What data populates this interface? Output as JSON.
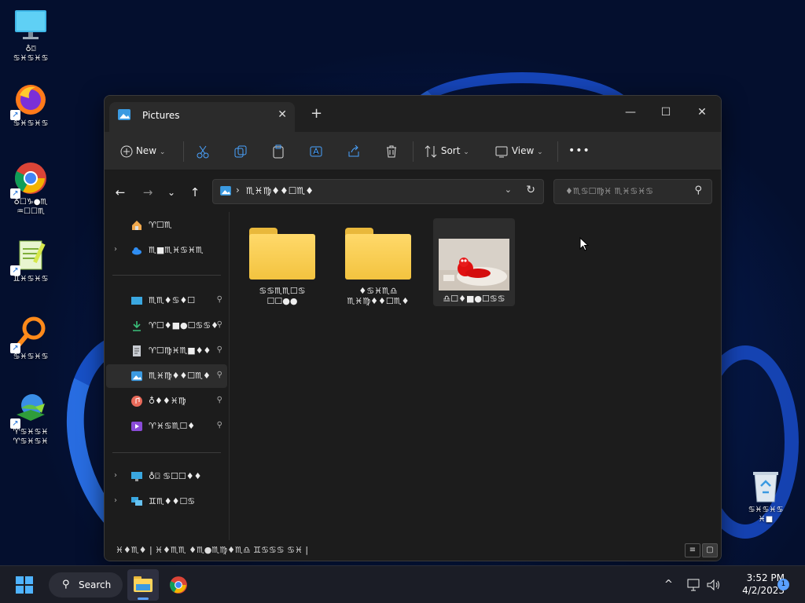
{
  "desktop": {
    "icons": [
      {
        "label": "♁⌼\n♋♓♋♓♋",
        "icon": "monitor-icon"
      },
      {
        "label": "♋♓♋♓♋",
        "icon": "firefox-icon"
      },
      {
        "label": "♁☐♑●♏\n♒☐☐♏",
        "icon": "chrome-icon"
      },
      {
        "label": "♊♓♋♓♋",
        "icon": "notepad-plus-icon"
      },
      {
        "label": "♋♓♋♓♋",
        "icon": "magnifier-app-icon"
      },
      {
        "label": "♈♋♓♋♓\n♈♋♓♋♓",
        "icon": "download-manager-icon"
      }
    ],
    "recycle_bin": {
      "label": "♋♓♋♓♋\n♓■"
    }
  },
  "window": {
    "tab_title": "Pictures",
    "new_tab": "+",
    "controls": {
      "minimize": "—",
      "maximize": "☐",
      "close": "✕"
    },
    "toolbar": {
      "new_label": "New",
      "sort_label": "Sort",
      "view_label": "View",
      "more": "•••"
    },
    "address": {
      "path": "♏♓♍♦♦☐♏♦"
    },
    "search": {
      "placeholder": "♦♏♋☐♍♓ ♏♓♋♓♋"
    },
    "sidebar": {
      "home": "♈☐♏",
      "onedrive": "♏■♏♓♋♓♏",
      "desktop": "♏♏♦♋♦☐",
      "downloads": "♈☐♦■●☐♋♋♦",
      "documents": "♈☐♍♓♏■♦♦",
      "pictures": "♏♓♍♦♦☐♏♦",
      "music": "♁♦♦♓♍",
      "videos": "♈♓♋♏☐♦",
      "this_pc": "♁⌼ ♋☐☐♦♦",
      "network": "♊♏♦♦☐♋"
    },
    "files": [
      {
        "label": "♋♋♏♏☐♋\n☐☐●●",
        "type": "folder"
      },
      {
        "label": "♦♋♓♏♎\n♏♓♍♦♦☐♏♦",
        "type": "folder"
      },
      {
        "label": "♎☐♦■●☐♋♋",
        "type": "image"
      }
    ],
    "status": {
      "text": "♓♦♏♦  |  ♓♦♏♏  ♦♏●♏♍♦♏♎  ♊♋♋♋  ♋♓  |"
    }
  },
  "taskbar": {
    "search_label": "Search",
    "time": "3:52 PM",
    "date": "4/2/2023",
    "notification_count": "1",
    "chevron": "^"
  }
}
